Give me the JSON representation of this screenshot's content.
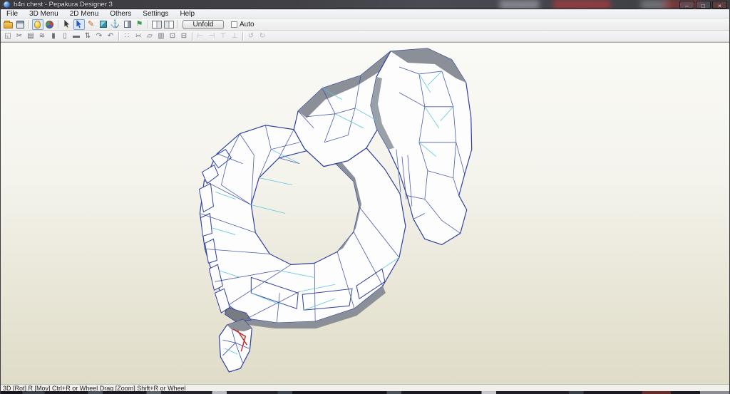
{
  "window": {
    "title": "h4n chest - Pepakura Designer 3",
    "controls": {
      "minimize": "–",
      "maximize": "□",
      "close": "×"
    }
  },
  "menubar": {
    "items": [
      {
        "label": "File"
      },
      {
        "label": "3D Menu"
      },
      {
        "label": "2D Menu"
      },
      {
        "label": "Others"
      },
      {
        "label": "Settings"
      },
      {
        "label": "Help"
      }
    ]
  },
  "toolbar_main": {
    "unfold_label": "Unfold",
    "auto_label": "Auto",
    "items": [
      {
        "type": "icon",
        "name": "open-file-button",
        "icon": "open-folder-icon",
        "style": "folder"
      },
      {
        "type": "icon",
        "name": "save-file-button",
        "icon": "save-floppy-icon",
        "style": "floppy"
      },
      {
        "type": "sep"
      },
      {
        "type": "icon",
        "name": "toggle-light-button",
        "icon": "light-bulb-icon",
        "style": "bulb",
        "pressed": true
      },
      {
        "type": "icon",
        "name": "toggle-texture-button",
        "icon": "color-ball-icon",
        "style": "ball"
      },
      {
        "type": "sep"
      },
      {
        "type": "icon",
        "name": "select-tool-button",
        "icon": "cursor-arrow-gold-icon",
        "style": "cursor-gold"
      },
      {
        "type": "icon",
        "name": "rotate-view-tool-button",
        "icon": "cursor-arrow-blue-icon",
        "style": "cursor-blue",
        "pressed": true
      },
      {
        "type": "icon",
        "name": "pen-tool-button",
        "icon": "pencil-icon",
        "glyph": "✎",
        "color": "#c8641e"
      },
      {
        "type": "icon",
        "name": "solid-view-button",
        "icon": "cube-icon",
        "style": "cube"
      },
      {
        "type": "icon",
        "name": "anchor-tool-button",
        "icon": "anchor-icon",
        "glyph": "⚓",
        "color": "#2b5cb8"
      },
      {
        "type": "icon",
        "name": "section-view-button",
        "icon": "half-box-icon",
        "style": "halfbox"
      },
      {
        "type": "icon",
        "name": "material-flag-button",
        "icon": "flag-icon",
        "glyph": "⚑",
        "color": "#3a9a50"
      },
      {
        "type": "sep"
      },
      {
        "type": "icon",
        "name": "layout-3d-pane-button",
        "icon": "layout-left-pane-icon",
        "style": "layout-l"
      },
      {
        "type": "icon",
        "name": "layout-2d-pane-button",
        "icon": "layout-right-pane-icon",
        "style": "layout-r"
      },
      {
        "type": "sep"
      }
    ]
  },
  "toolbar_2d": {
    "items": [
      {
        "type": "icon",
        "name": "select-2d-button",
        "icon": "selection-frame-icon",
        "glyph": "◱"
      },
      {
        "type": "icon",
        "name": "edge-cut-button",
        "icon": "scissors-icon",
        "glyph": "✂"
      },
      {
        "type": "icon",
        "name": "texture-image-button",
        "icon": "image-icon",
        "glyph": "▤"
      },
      {
        "type": "icon",
        "name": "corrugation-button",
        "icon": "waves-icon",
        "glyph": "≋"
      },
      {
        "type": "icon",
        "name": "edge-id-button",
        "icon": "cylinder-icon",
        "glyph": "▮"
      },
      {
        "type": "icon",
        "name": "page-view-button",
        "icon": "page-icon",
        "glyph": "▯"
      },
      {
        "type": "icon",
        "name": "dark-panel-button",
        "icon": "dark-panel-icon",
        "glyph": "▬"
      },
      {
        "type": "icon",
        "name": "flip-piece-button",
        "icon": "flip-icon",
        "glyph": "⇅"
      },
      {
        "type": "icon",
        "name": "rotate-piece-cw-button",
        "icon": "rotate-cw-icon",
        "glyph": "↷"
      },
      {
        "type": "icon",
        "name": "rotate-piece-ccw-button",
        "icon": "rotate-ccw-icon",
        "glyph": "↶"
      },
      {
        "type": "sep"
      },
      {
        "type": "icon",
        "name": "dashed-select-button",
        "icon": "dashed-frame-icon",
        "glyph": "∷"
      },
      {
        "type": "icon",
        "name": "snap-grid-button",
        "icon": "grid-icon",
        "glyph": "∺"
      },
      {
        "type": "icon",
        "name": "piece-label-button",
        "icon": "label-icon",
        "glyph": "▱"
      },
      {
        "type": "icon",
        "name": "stack-order-button",
        "icon": "stack-icon",
        "glyph": "▥"
      },
      {
        "type": "icon",
        "name": "boxed-view-button",
        "icon": "boxed-icon",
        "glyph": "⊡"
      },
      {
        "type": "icon",
        "name": "flatten-button",
        "icon": "flatten-icon",
        "glyph": "⊟"
      },
      {
        "type": "sep"
      },
      {
        "type": "icon",
        "name": "align-left-button",
        "icon": "align-left-icon",
        "glyph": "⊢",
        "disabled": true
      },
      {
        "type": "icon",
        "name": "align-right-button",
        "icon": "align-right-icon",
        "glyph": "⊣",
        "disabled": true
      },
      {
        "type": "icon",
        "name": "align-top-button",
        "icon": "align-top-icon",
        "glyph": "⊤",
        "disabled": true
      },
      {
        "type": "icon",
        "name": "align-bottom-button",
        "icon": "align-bottom-icon",
        "glyph": "⊥",
        "disabled": true
      },
      {
        "type": "sep"
      },
      {
        "type": "icon",
        "name": "rotate-90-ccw-button",
        "icon": "rotate-90-ccw-icon",
        "glyph": "↺",
        "disabled": true
      },
      {
        "type": "icon",
        "name": "rotate-90-cw-button",
        "icon": "rotate-90-cw-icon",
        "glyph": "↻",
        "disabled": true
      }
    ]
  },
  "statusbar": {
    "text": "3D [Rot] R [Mov] Ctrl+R or Wheel Drag [Zoom] Shift+R or Wheel"
  },
  "viewport": {
    "bg_top": "#fafaf6",
    "bg_bottom": "#dfdcc8"
  },
  "colors": {
    "edge_blue": "#2e3f9f",
    "fold_cyan": "#55c6da",
    "cut_red": "#c42020",
    "shade_gray": "#8b9098",
    "face_white": "#fdfdfd",
    "pressed_bg": "#d9e7f8",
    "pressed_border": "#7aa0cc"
  }
}
